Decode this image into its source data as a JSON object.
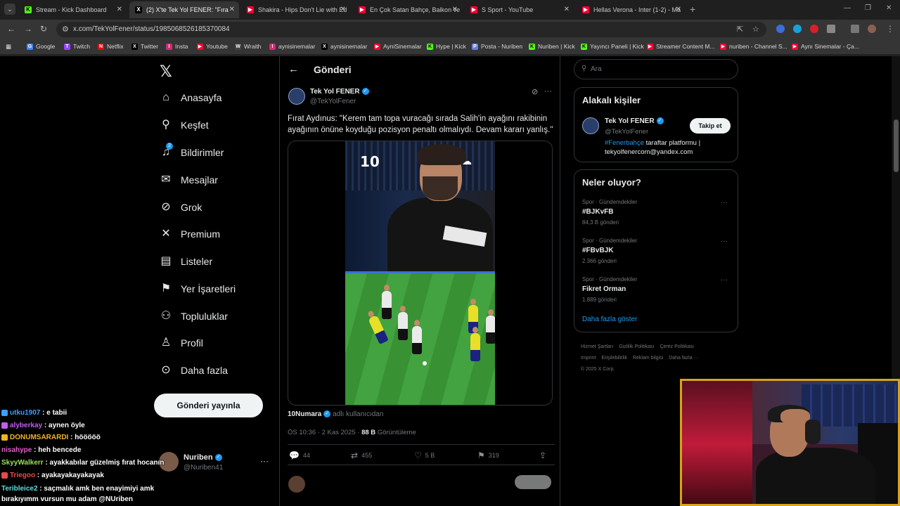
{
  "browser": {
    "tabs": [
      {
        "title": "Stream - Kick Dashboard",
        "icon": "kick-icon",
        "color": "#53fc18",
        "active": false
      },
      {
        "title": "(2) X'te Tek Yol FENER: \"Fıra",
        "icon": "x-icon",
        "color": "#ffffff",
        "active": true
      },
      {
        "title": "Shakira - Hips Don't Lie with Ed",
        "icon": "youtube-icon",
        "color": "#ff0033",
        "active": false
      },
      {
        "title": "En Çok Satan Bahçe, Balkon ve",
        "icon": "youtube-icon",
        "color": "#ff0033",
        "active": false
      },
      {
        "title": "S Sport - YouTube",
        "icon": "youtube-icon",
        "color": "#ff0033",
        "active": false
      },
      {
        "title": "Hellas Verona - Inter (1-2) - Ma",
        "icon": "youtube-icon",
        "color": "#ff0033",
        "active": false
      }
    ],
    "url": "x.com/TekYolFener/status/1985068526185370084",
    "bookmarks": [
      {
        "label": "Google",
        "color": "#4285f4",
        "glyph": "G"
      },
      {
        "label": "Twitch",
        "color": "#9146ff",
        "glyph": "T"
      },
      {
        "label": "Netflix",
        "color": "#e50914",
        "glyph": "N"
      },
      {
        "label": "Twitter",
        "color": "#000000",
        "glyph": "X"
      },
      {
        "label": "Insta",
        "color": "#d62976",
        "glyph": "I"
      },
      {
        "label": "Youtube",
        "color": "#ff0033",
        "glyph": "▶"
      },
      {
        "label": "Wraith",
        "color": "#444444",
        "glyph": "W"
      },
      {
        "label": "aynisinemalar",
        "color": "#d62976",
        "glyph": "I"
      },
      {
        "label": "aynisinemalar",
        "color": "#000000",
        "glyph": "X"
      },
      {
        "label": "AyniSinemalar",
        "color": "#ff0033",
        "glyph": "▶"
      },
      {
        "label": "Hype | Kick",
        "color": "#53fc18",
        "glyph": "K"
      },
      {
        "label": "Posta - Nuriben",
        "color": "#6a7fdb",
        "glyph": "P"
      },
      {
        "label": "Nuriben | Kick",
        "color": "#53fc18",
        "glyph": "K"
      },
      {
        "label": "Yayıncı Paneli | Kick",
        "color": "#53fc18",
        "glyph": "K"
      },
      {
        "label": "Streamer Content M...",
        "color": "#ff0033",
        "glyph": "▶"
      },
      {
        "label": "nuriben - Channel S...",
        "color": "#ff0033",
        "glyph": "▶"
      },
      {
        "label": "Aynı Sinemalar - Ça...",
        "color": "#ff0033",
        "glyph": "▶"
      }
    ]
  },
  "leftnav": {
    "items": [
      {
        "label": "Anasayfa",
        "icon": "home-icon",
        "glyph": "⌂"
      },
      {
        "label": "Keşfet",
        "icon": "search-icon",
        "glyph": "⚲"
      },
      {
        "label": "Bildirimler",
        "icon": "bell-icon",
        "glyph": "🔔",
        "badge": "2"
      },
      {
        "label": "Mesajlar",
        "icon": "mail-icon",
        "glyph": "✉"
      },
      {
        "label": "Grok",
        "icon": "grok-icon",
        "glyph": "⊘"
      },
      {
        "label": "Premium",
        "icon": "x-icon",
        "glyph": "✕"
      },
      {
        "label": "Listeler",
        "icon": "list-icon",
        "glyph": "▤"
      },
      {
        "label": "Yer İşaretleri",
        "icon": "bookmark-icon",
        "glyph": "⚑"
      },
      {
        "label": "Topluluklar",
        "icon": "communities-icon",
        "glyph": "⚇"
      },
      {
        "label": "Profil",
        "icon": "profile-icon",
        "glyph": "♙"
      },
      {
        "label": "Daha fazla",
        "icon": "more-circle-icon",
        "glyph": "⊙"
      }
    ],
    "post_button": "Gönderi yayınla",
    "profile": {
      "name": "Nuriben",
      "handle": "@Nuriben41"
    }
  },
  "post": {
    "header_title": "Gönderi",
    "author_name": "Tek Yol FENER",
    "author_handle": "@TekYolFener",
    "text": "Fırat Aydınus: \"Kerem tam topa vuracağı sırada Salih'in ayağını rakibinin ayağının önüne koyduğu pozisyon penaltı olmalıydı. Devam kararı yanlış.\"",
    "video_overlay_number": "10",
    "attribution_user": "10Numara",
    "attribution_suffix": "adlı kullanıcıdan",
    "time": "ÖS 10:36 · 2 Kas 2025 ·",
    "views": "88 B",
    "views_label": "Görüntüleme",
    "stats": {
      "replies": "44",
      "reposts": "455",
      "likes": "5 B",
      "bookmarks": "319"
    }
  },
  "right": {
    "search_placeholder": "Ara",
    "related_title": "Alakalı kişiler",
    "related": {
      "name": "Tek Yol FENER",
      "handle": "@TekYolFener",
      "follow_label": "Takip et",
      "bio_hashtag": "#Fenerbahçe",
      "bio_rest": " taraftar platformu | tekyolfenercom@yandex.com"
    },
    "trends_title": "Neler oluyor?",
    "trends": [
      {
        "category": "Spor · Gündemdekiler",
        "name": "#BJKvFB",
        "count": "84,3 B gönderi"
      },
      {
        "category": "Spor · Gündemdekiler",
        "name": "#FBvBJK",
        "count": "2.366 gönderi"
      },
      {
        "category": "Spor · Gündemdekiler",
        "name": "Fikret Orman",
        "count": "1.889 gönderi"
      }
    ],
    "show_more": "Daha fazla göster",
    "footer": [
      "Hizmet Şartları",
      "Gizlilik Politikası",
      "Çerez Politikası",
      "Imprint",
      "Erişilebilirlik",
      "Reklam bilgisi",
      "Daha fazla ···",
      "© 2025 X Corp."
    ]
  },
  "chat": [
    {
      "user": "utku1907",
      "msg": " : e tabii",
      "color": "#3aa0ff"
    },
    {
      "user": "alyberkay",
      "msg": " : aynen öyle",
      "color": "#c45cf0"
    },
    {
      "user": "DONUMSARARDI",
      "msg": " : hööööö",
      "color": "#f0b429"
    },
    {
      "user": "nisahype",
      "msg": " : heh bencede",
      "color": "#e05cc8"
    },
    {
      "user": "SkyyWalkerr",
      "msg": " : ayakkabılar güzelmiş fırat hocanın",
      "color": "#9be15d"
    },
    {
      "user": "Triegoo",
      "msg": " : ayakayakayakayak",
      "color": "#e84a4a"
    },
    {
      "user": "Teribleice2",
      "msg": " : saçmalık amk ben enayimiyi amk bırakıyımm vursun mu adam @NUriben",
      "color": "#5ce0e0"
    }
  ]
}
